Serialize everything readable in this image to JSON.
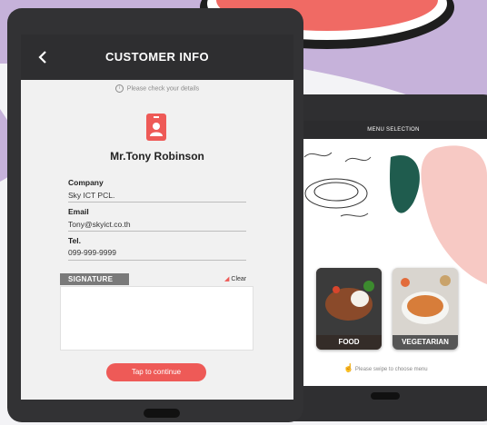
{
  "header": {
    "title": "CUSTOMER INFO"
  },
  "hint": "Please check your details",
  "customer": {
    "name": "Mr.Tony Robinson",
    "fields": [
      {
        "label": "Company",
        "value": "Sky ICT PCL."
      },
      {
        "label": "Email",
        "value": "Tony@skyict.co.th"
      },
      {
        "label": "Tel.",
        "value": "099-999-9999"
      }
    ]
  },
  "signature": {
    "tab": "SIGNATURE",
    "clear": "Clear"
  },
  "continue_label": "Tap to continue",
  "menu": {
    "title": "MENU SELECTION",
    "cards": [
      {
        "label": "FOOD"
      },
      {
        "label": "VEGETARIAN"
      }
    ],
    "swipe_hint": "Please swipe to choose menu"
  },
  "colors": {
    "accent": "#ee5a57",
    "header": "#2e2e30",
    "purple": "#c6b2da",
    "coral": "#f06a64"
  }
}
